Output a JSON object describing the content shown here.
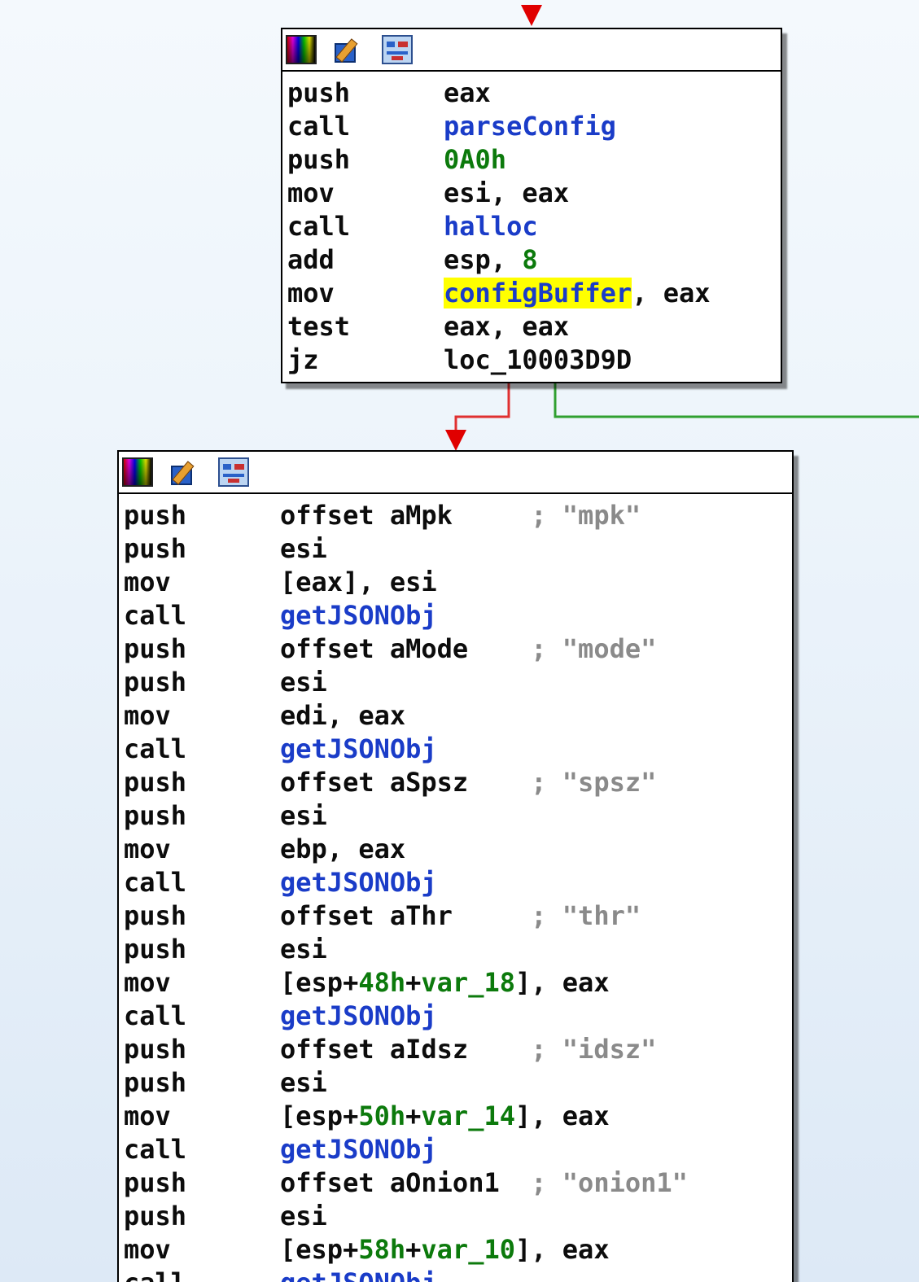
{
  "blocks": [
    {
      "id": "block-1",
      "lines": [
        {
          "mnemonic": "push",
          "operand": [
            {
              "t": "eax",
              "k": "op"
            }
          ]
        },
        {
          "mnemonic": "call",
          "operand": [
            {
              "t": "parseConfig",
              "k": "fn"
            }
          ]
        },
        {
          "mnemonic": "push",
          "operand": [
            {
              "t": "0A0h",
              "k": "num"
            }
          ]
        },
        {
          "mnemonic": "mov",
          "operand": [
            {
              "t": "esi, eax",
              "k": "op"
            }
          ]
        },
        {
          "mnemonic": "call",
          "operand": [
            {
              "t": "halloc",
              "k": "fn"
            }
          ]
        },
        {
          "mnemonic": "add",
          "operand": [
            {
              "t": "esp, ",
              "k": "op"
            },
            {
              "t": "8",
              "k": "num"
            }
          ]
        },
        {
          "mnemonic": "mov",
          "operand": [
            {
              "t": "configBuffer",
              "k": "hl"
            },
            {
              "t": ", eax",
              "k": "op"
            }
          ]
        },
        {
          "mnemonic": "test",
          "operand": [
            {
              "t": "eax, eax",
              "k": "op"
            }
          ]
        },
        {
          "mnemonic": "jz",
          "operand": [
            {
              "t": "loc_10003D9D",
              "k": "op"
            }
          ]
        }
      ]
    },
    {
      "id": "block-2",
      "lines": [
        {
          "mnemonic": "push",
          "operand": [
            {
              "t": "offset aMpk     ",
              "k": "op"
            }
          ],
          "comment": "; \"mpk\""
        },
        {
          "mnemonic": "push",
          "operand": [
            {
              "t": "esi",
              "k": "op"
            }
          ]
        },
        {
          "mnemonic": "mov",
          "operand": [
            {
              "t": "[eax], esi",
              "k": "op"
            }
          ]
        },
        {
          "mnemonic": "call",
          "operand": [
            {
              "t": "getJSONObj",
              "k": "fn"
            }
          ]
        },
        {
          "mnemonic": "push",
          "operand": [
            {
              "t": "offset aMode    ",
              "k": "op"
            }
          ],
          "comment": "; \"mode\""
        },
        {
          "mnemonic": "push",
          "operand": [
            {
              "t": "esi",
              "k": "op"
            }
          ]
        },
        {
          "mnemonic": "mov",
          "operand": [
            {
              "t": "edi, eax",
              "k": "op"
            }
          ]
        },
        {
          "mnemonic": "call",
          "operand": [
            {
              "t": "getJSONObj",
              "k": "fn"
            }
          ]
        },
        {
          "mnemonic": "push",
          "operand": [
            {
              "t": "offset aSpsz    ",
              "k": "op"
            }
          ],
          "comment": "; \"spsz\""
        },
        {
          "mnemonic": "push",
          "operand": [
            {
              "t": "esi",
              "k": "op"
            }
          ]
        },
        {
          "mnemonic": "mov",
          "operand": [
            {
              "t": "ebp, eax",
              "k": "op"
            }
          ]
        },
        {
          "mnemonic": "call",
          "operand": [
            {
              "t": "getJSONObj",
              "k": "fn"
            }
          ]
        },
        {
          "mnemonic": "push",
          "operand": [
            {
              "t": "offset aThr     ",
              "k": "op"
            }
          ],
          "comment": "; \"thr\""
        },
        {
          "mnemonic": "push",
          "operand": [
            {
              "t": "esi",
              "k": "op"
            }
          ]
        },
        {
          "mnemonic": "mov",
          "operand": [
            {
              "t": "[esp+",
              "k": "op"
            },
            {
              "t": "48h",
              "k": "num"
            },
            {
              "t": "+",
              "k": "op"
            },
            {
              "t": "var_18",
              "k": "num"
            },
            {
              "t": "], eax",
              "k": "op"
            }
          ]
        },
        {
          "mnemonic": "call",
          "operand": [
            {
              "t": "getJSONObj",
              "k": "fn"
            }
          ]
        },
        {
          "mnemonic": "push",
          "operand": [
            {
              "t": "offset aIdsz    ",
              "k": "op"
            }
          ],
          "comment": "; \"idsz\""
        },
        {
          "mnemonic": "push",
          "operand": [
            {
              "t": "esi",
              "k": "op"
            }
          ]
        },
        {
          "mnemonic": "mov",
          "operand": [
            {
              "t": "[esp+",
              "k": "op"
            },
            {
              "t": "50h",
              "k": "num"
            },
            {
              "t": "+",
              "k": "op"
            },
            {
              "t": "var_14",
              "k": "num"
            },
            {
              "t": "], eax",
              "k": "op"
            }
          ]
        },
        {
          "mnemonic": "call",
          "operand": [
            {
              "t": "getJSONObj",
              "k": "fn"
            }
          ]
        },
        {
          "mnemonic": "push",
          "operand": [
            {
              "t": "offset aOnion1  ",
              "k": "op"
            }
          ],
          "comment": "; \"onion1\""
        },
        {
          "mnemonic": "push",
          "operand": [
            {
              "t": "esi",
              "k": "op"
            }
          ]
        },
        {
          "mnemonic": "mov",
          "operand": [
            {
              "t": "[esp+",
              "k": "op"
            },
            {
              "t": "58h",
              "k": "num"
            },
            {
              "t": "+",
              "k": "op"
            },
            {
              "t": "var_10",
              "k": "num"
            },
            {
              "t": "], eax",
              "k": "op"
            }
          ]
        },
        {
          "mnemonic": "call",
          "operand": [
            {
              "t": "getJSONObj",
              "k": "fn"
            }
          ]
        }
      ]
    }
  ],
  "colors": {
    "edge_false": "#e03030",
    "edge_true": "#30a030",
    "edge_incoming": "#e00000",
    "function_name": "#1a3cc8",
    "number": "#0c7a0c",
    "highlight": "#ffff00",
    "comment": "#8a8a8a"
  },
  "header_icons": [
    "color-palette-icon",
    "rename-pencil-icon",
    "graph-overview-icon"
  ]
}
